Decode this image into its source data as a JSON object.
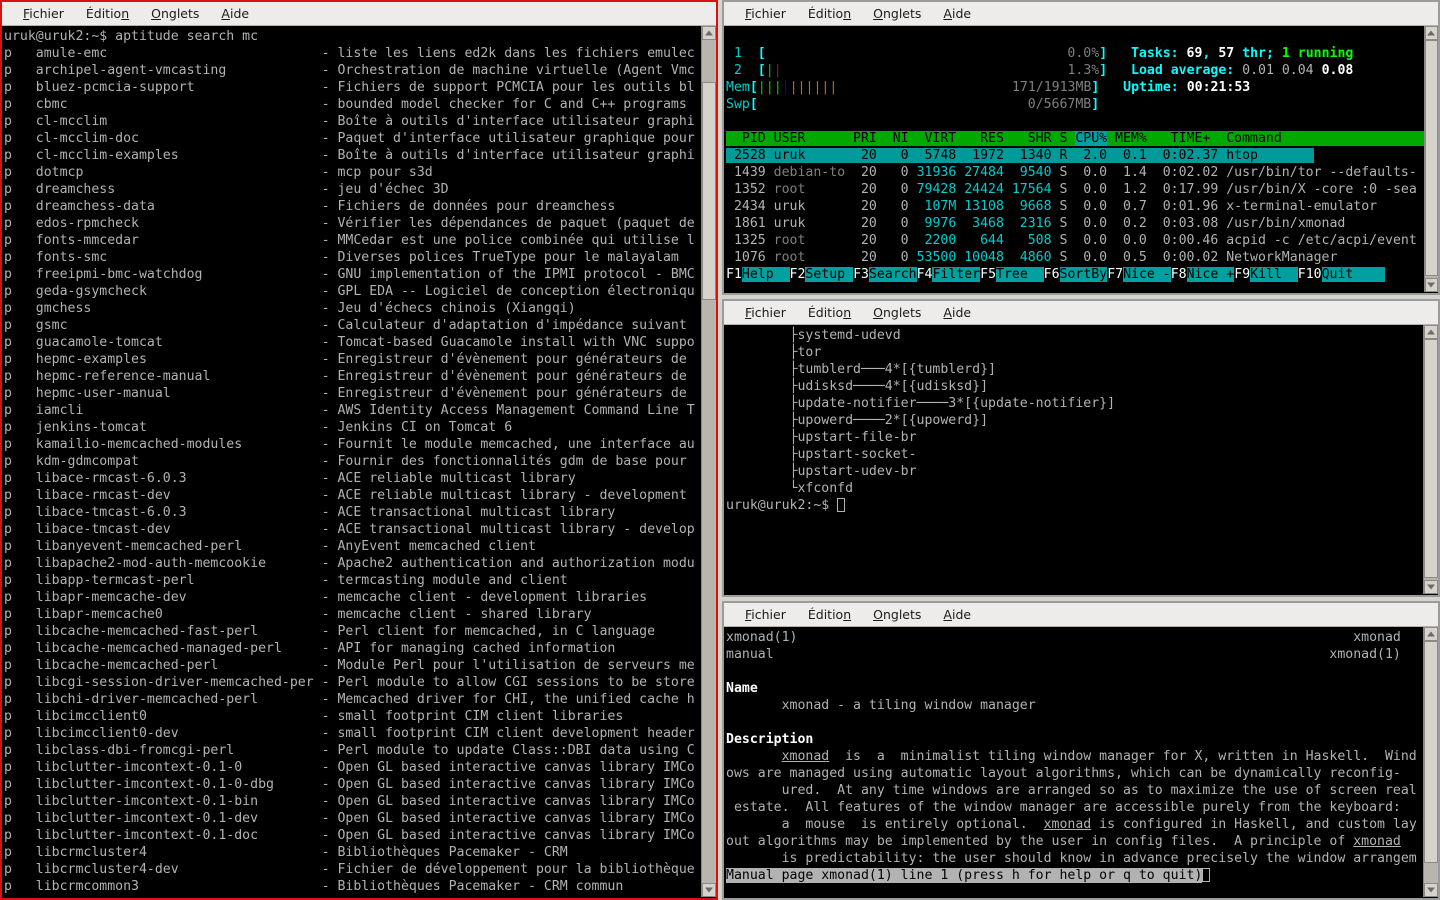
{
  "menu": {
    "items": [
      {
        "label": "Fichier",
        "accel_index": 0
      },
      {
        "label": "Édition",
        "accel_index": 6
      },
      {
        "label": "Onglets",
        "accel_index": 1
      },
      {
        "label": "Aide",
        "accel_index": 0
      }
    ]
  },
  "colors": {
    "focused_border": "#d81212",
    "unfocused_border": "#9b9b9b",
    "terminal_bg": "#000000",
    "terminal_fg": "#b2b2b2",
    "htop_header_bg": "#00a800",
    "htop_sort_bg": "#00a0a0",
    "htop_selected_bg": "#009a9a",
    "menubar_bg": "#edeceb"
  },
  "aptitude": {
    "title": "aptitude search mc",
    "prompt": "uruk@uruk2:~$",
    "command": "aptitude search mc",
    "state_flag": "p",
    "packages": [
      {
        "flag": "p",
        "name": "amule-emc",
        "desc": "liste les liens ed2k dans les fichiers emulec"
      },
      {
        "flag": "p",
        "name": "archipel-agent-vmcasting",
        "desc": "Orchestration de machine virtuelle (Agent Vmc"
      },
      {
        "flag": "p",
        "name": "bluez-pcmcia-support",
        "desc": "Fichiers de support PCMCIA pour les outils bl"
      },
      {
        "flag": "p",
        "name": "cbmc",
        "desc": "bounded model checker for C and C++ programs"
      },
      {
        "flag": "p",
        "name": "cl-mcclim",
        "desc": "Boîte à outils d'interface utilisateur graphi"
      },
      {
        "flag": "p",
        "name": "cl-mcclim-doc",
        "desc": "Paquet d'interface utilisateur graphique pour"
      },
      {
        "flag": "p",
        "name": "cl-mcclim-examples",
        "desc": "Boîte à outils d'interface utilisateur graphi"
      },
      {
        "flag": "p",
        "name": "dotmcp",
        "desc": "mcp pour s3d"
      },
      {
        "flag": "p",
        "name": "dreamchess",
        "desc": "jeu d'échec 3D"
      },
      {
        "flag": "p",
        "name": "dreamchess-data",
        "desc": "Fichiers de données pour dreamchess"
      },
      {
        "flag": "p",
        "name": "edos-rpmcheck",
        "desc": "Vérifier les dépendances de paquet (paquet de"
      },
      {
        "flag": "p",
        "name": "fonts-mmcedar",
        "desc": "MMCedar est une police combinée qui utilise l"
      },
      {
        "flag": "p",
        "name": "fonts-smc",
        "desc": "Diverses polices TrueType pour le malayalam"
      },
      {
        "flag": "p",
        "name": "freeipmi-bmc-watchdog",
        "desc": "GNU implementation of the IPMI protocol - BMC"
      },
      {
        "flag": "p",
        "name": "geda-gsymcheck",
        "desc": "GPL EDA -- Logiciel de conception électroniqu"
      },
      {
        "flag": "p",
        "name": "gmchess",
        "desc": "Jeu d'échecs chinois (Xiangqi)"
      },
      {
        "flag": "p",
        "name": "gsmc",
        "desc": "Calculateur d'adaptation d'impédance suivant"
      },
      {
        "flag": "p",
        "name": "guacamole-tomcat",
        "desc": "Tomcat-based Guacamole install with VNC suppo"
      },
      {
        "flag": "p",
        "name": "hepmc-examples",
        "desc": "Enregistreur d'évènement pour générateurs de"
      },
      {
        "flag": "p",
        "name": "hepmc-reference-manual",
        "desc": "Enregistreur d'évènement pour générateurs de"
      },
      {
        "flag": "p",
        "name": "hepmc-user-manual",
        "desc": "Enregistreur d'évènement pour générateurs de"
      },
      {
        "flag": "p",
        "name": "iamcli",
        "desc": "AWS Identity Access Management Command Line T"
      },
      {
        "flag": "p",
        "name": "jenkins-tomcat",
        "desc": "Jenkins CI on Tomcat 6"
      },
      {
        "flag": "p",
        "name": "kamailio-memcached-modules",
        "desc": "Fournit le module memcached, une interface au"
      },
      {
        "flag": "p",
        "name": "kdm-gdmcompat",
        "desc": "Fournir des fonctionnalités gdm de base pour"
      },
      {
        "flag": "p",
        "name": "libace-rmcast-6.0.3",
        "desc": "ACE reliable multicast library"
      },
      {
        "flag": "p",
        "name": "libace-rmcast-dev",
        "desc": "ACE reliable multicast library - development"
      },
      {
        "flag": "p",
        "name": "libace-tmcast-6.0.3",
        "desc": "ACE transactional multicast library"
      },
      {
        "flag": "p",
        "name": "libace-tmcast-dev",
        "desc": "ACE transactional multicast library - develop"
      },
      {
        "flag": "p",
        "name": "libanyevent-memcached-perl",
        "desc": "AnyEvent memcached client"
      },
      {
        "flag": "p",
        "name": "libapache2-mod-auth-memcookie",
        "desc": "Apache2 authentication and authorization modu"
      },
      {
        "flag": "p",
        "name": "libapp-termcast-perl",
        "desc": "termcasting module and client"
      },
      {
        "flag": "p",
        "name": "libapr-memcache-dev",
        "desc": "memcache client - development libraries"
      },
      {
        "flag": "p",
        "name": "libapr-memcache0",
        "desc": "memcache client - shared library"
      },
      {
        "flag": "p",
        "name": "libcache-memcached-fast-perl",
        "desc": "Perl client for memcached, in C language"
      },
      {
        "flag": "p",
        "name": "libcache-memcached-managed-perl",
        "desc": "API for managing cached information"
      },
      {
        "flag": "p",
        "name": "libcache-memcached-perl",
        "desc": "Module Perl pour l'utilisation de serveurs me"
      },
      {
        "flag": "p",
        "name": "libcgi-session-driver-memcached-per",
        "desc": "Perl module to allow CGI sessions to be store"
      },
      {
        "flag": "p",
        "name": "libchi-driver-memcached-perl",
        "desc": "Memcached driver for CHI, the unified cache h"
      },
      {
        "flag": "p",
        "name": "libcimcclient0",
        "desc": "small footprint CIM client libraries"
      },
      {
        "flag": "p",
        "name": "libcimcclient0-dev",
        "desc": "small footprint CIM client development header"
      },
      {
        "flag": "p",
        "name": "libclass-dbi-fromcgi-perl",
        "desc": "Perl module to update Class::DBI data using C"
      },
      {
        "flag": "p",
        "name": "libclutter-imcontext-0.1-0",
        "desc": "Open GL based interactive canvas library IMCo"
      },
      {
        "flag": "p",
        "name": "libclutter-imcontext-0.1-0-dbg",
        "desc": "Open GL based interactive canvas library IMCo"
      },
      {
        "flag": "p",
        "name": "libclutter-imcontext-0.1-bin",
        "desc": "Open GL based interactive canvas library IMCo"
      },
      {
        "flag": "p",
        "name": "libclutter-imcontext-0.1-dev",
        "desc": "Open GL based interactive canvas library IMCo"
      },
      {
        "flag": "p",
        "name": "libclutter-imcontext-0.1-doc",
        "desc": "Open GL based interactive canvas library IMCo"
      },
      {
        "flag": "p",
        "name": "libcrmcluster4",
        "desc": "Bibliothèques Pacemaker - CRM"
      },
      {
        "flag": "p",
        "name": "libcrmcluster4-dev",
        "desc": "Fichier de développement pour la bibliothèque"
      },
      {
        "flag": "p",
        "name": "libcrmcommon3",
        "desc": "Bibliothèques Pacemaker - CRM commun"
      }
    ]
  },
  "htop": {
    "cpus": [
      {
        "id": "1",
        "pct": "0.0%",
        "bars": []
      },
      {
        "id": "2",
        "pct": "1.3%",
        "bars": [
          "green",
          "red"
        ]
      }
    ],
    "mem": {
      "label": "Mem",
      "value": "171/1913MB",
      "bars": [
        "green",
        "green",
        "green",
        "blue",
        "orange",
        "orange",
        "orange",
        "orange",
        "orange",
        "orange"
      ]
    },
    "swp": {
      "label": "Swp",
      "value": "0/5667MB",
      "bars": []
    },
    "tasks_label": "Tasks:",
    "tasks_total": "69",
    "tasks_thr": "57",
    "tasks_thr_label": "thr;",
    "tasks_running": "1",
    "tasks_running_label": "running",
    "load_label": "Load average:",
    "load": [
      "0.01",
      "0.04",
      "0.08"
    ],
    "uptime_label": "Uptime:",
    "uptime": "00:21:53",
    "columns": [
      "PID",
      "USER",
      "PRI",
      "NI",
      "VIRT",
      "RES",
      "SHR",
      "S",
      "CPU%",
      "MEM%",
      "TIME+",
      "Command"
    ],
    "sort_column": "CPU%",
    "rows": [
      {
        "pid": "2528",
        "user": "uruk",
        "pri": "20",
        "ni": "0",
        "virt": "5748",
        "res": "1972",
        "shr": "1340",
        "s": "R",
        "cpu": "2.0",
        "mem": "0.1",
        "time": "0:02.37",
        "cmd": "htop",
        "selected": true
      },
      {
        "pid": "1439",
        "user": "debian-to",
        "pri": "20",
        "ni": "0",
        "virt": "31936",
        "res": "27484",
        "shr": "9540",
        "s": "S",
        "cpu": "0.0",
        "mem": "1.4",
        "time": "0:02.02",
        "cmd": "/usr/bin/tor --defaults-",
        "selected": false
      },
      {
        "pid": "1352",
        "user": "root",
        "pri": "20",
        "ni": "0",
        "virt": "79428",
        "res": "24424",
        "shr": "17564",
        "s": "S",
        "cpu": "0.0",
        "mem": "1.2",
        "time": "0:17.99",
        "cmd": "/usr/bin/X -core :0 -sea",
        "selected": false
      },
      {
        "pid": "2434",
        "user": "uruk",
        "pri": "20",
        "ni": "0",
        "virt": "107M",
        "res": "13108",
        "shr": "9668",
        "s": "S",
        "cpu": "0.0",
        "mem": "0.7",
        "time": "0:01.96",
        "cmd": "x-terminal-emulator",
        "selected": false
      },
      {
        "pid": "1861",
        "user": "uruk",
        "pri": "20",
        "ni": "0",
        "virt": "9976",
        "res": "3468",
        "shr": "2316",
        "s": "S",
        "cpu": "0.0",
        "mem": "0.2",
        "time": "0:03.08",
        "cmd": "/usr/bin/xmonad",
        "selected": false
      },
      {
        "pid": "1325",
        "user": "root",
        "pri": "20",
        "ni": "0",
        "virt": "2200",
        "res": "644",
        "shr": "508",
        "s": "S",
        "cpu": "0.0",
        "mem": "0.0",
        "time": "0:00.46",
        "cmd": "acpid -c /etc/acpi/event",
        "selected": false
      },
      {
        "pid": "1076",
        "user": "root",
        "pri": "20",
        "ni": "0",
        "virt": "53500",
        "res": "10048",
        "shr": "4860",
        "s": "S",
        "cpu": "0.0",
        "mem": "0.5",
        "time": "0:00.02",
        "cmd": "NetworkManager",
        "selected": false
      }
    ],
    "fkeys": [
      {
        "key": "F1",
        "label": "Help  "
      },
      {
        "key": "F2",
        "label": "Setup "
      },
      {
        "key": "F3",
        "label": "Search"
      },
      {
        "key": "F4",
        "label": "Filter"
      },
      {
        "key": "F5",
        "label": "Tree  "
      },
      {
        "key": "F6",
        "label": "SortBy"
      },
      {
        "key": "F7",
        "label": "Nice -"
      },
      {
        "key": "F8",
        "label": "Nice +"
      },
      {
        "key": "F9",
        "label": "Kill  "
      },
      {
        "key": "F10",
        "label": "Quit"
      }
    ]
  },
  "pstree": {
    "lines": [
      "        ├systemd-udevd",
      "        ├tor",
      "        ├tumblerd───4*[{tumblerd}]",
      "        ├udisksd────4*[{udisksd}]",
      "        ├update-notifier────3*[{update-notifier}]",
      "        ├upowerd────2*[{upowerd}]",
      "        ├upstart-file-br",
      "        ├upstart-socket-",
      "        ├upstart-udev-br",
      "        └xfconfd"
    ],
    "prompt": "uruk@uruk2:~$"
  },
  "man": {
    "header_left": "xmonad(1)",
    "header_right": "xmonad",
    "subheader_left": "manual",
    "subheader_right": "xmonad(1)",
    "section_name": "Name",
    "name_body": "xmonad - a tiling window manager",
    "section_description": "Description",
    "description_lines": [
      "       xmonad  is  a  minimalist tiling window manager for X, written in Haskell.  Wind",
      "ows are managed using automatic layout algorithms, which can be dynamically reconfig-",
      "       ured.  At any time windows are arranged so as to maximize the use of screen real",
      " estate.  All features of the window manager are accessible purely from the keyboard:",
      "       a  mouse  is entirely optional.  xmonad is configured in Haskell, and custom lay",
      "out algorithms may be implemented by the user in config files.  A principle of xmonad",
      "       is predictability: the user should know in advance precisely the window arrangem"
    ],
    "status_line": "Manual page xmonad(1) line 1 (press h for help or q to quit)"
  }
}
